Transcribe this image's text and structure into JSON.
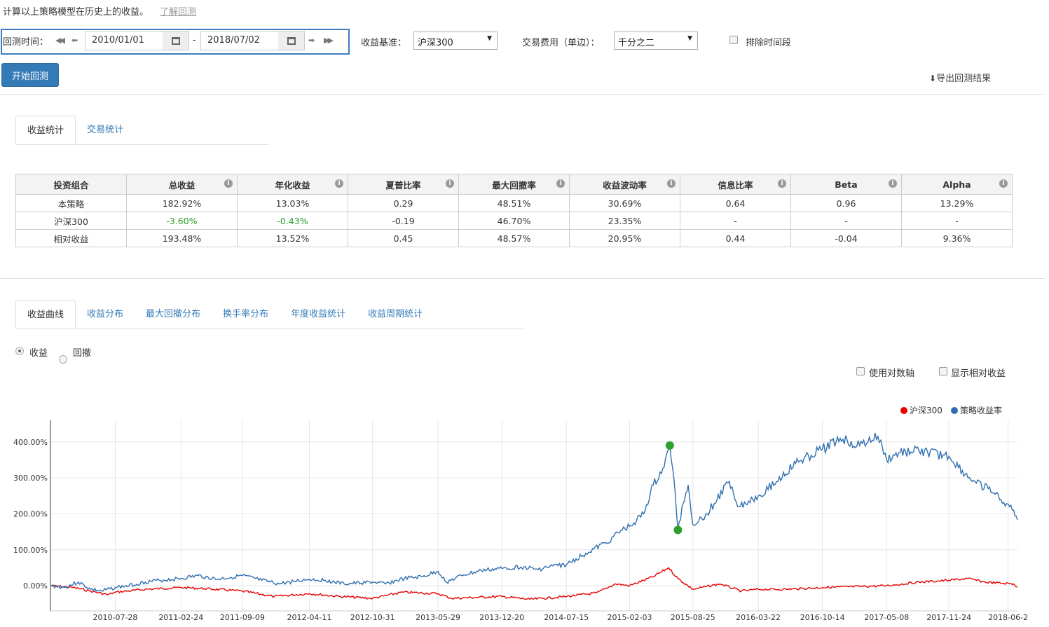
{
  "intro": {
    "text": "计算以上策略模型在历史上的收益。",
    "link": "了解回测"
  },
  "controls": {
    "range_label": "回测时间：",
    "start_date": "2010/01/01",
    "end_date": "2018/07/02",
    "dash": "-",
    "benchmark_label": "收益基准：",
    "benchmark_value": "沪深300",
    "fee_label": "交易费用（单边）：",
    "fee_value": "千分之二",
    "exclude_label": "排除时间段",
    "start_button": "开始回测",
    "export_label": "导出回测结果"
  },
  "stat_tabs": [
    "收益统计",
    "交易统计"
  ],
  "stats_table": {
    "headers": [
      "投资组合",
      "总收益",
      "年化收益",
      "夏普比率",
      "最大回撤率",
      "收益波动率",
      "信息比率",
      "Beta",
      "Alpha"
    ],
    "rows": [
      [
        "本策略",
        "182.92%",
        "13.03%",
        "0.29",
        "48.51%",
        "30.69%",
        "0.64",
        "0.96",
        "13.29%"
      ],
      [
        "沪深300",
        "-3.60%",
        "-0.43%",
        "-0.19",
        "46.70%",
        "23.35%",
        "-",
        "-",
        "-"
      ],
      [
        "相对收益",
        "193.48%",
        "13.52%",
        "0.45",
        "48.57%",
        "20.95%",
        "0.44",
        "-0.04",
        "9.36%"
      ]
    ]
  },
  "chart_tabs": [
    "收益曲线",
    "收益分布",
    "最大回撤分布",
    "换手率分布",
    "年度收益统计",
    "收益周期统计"
  ],
  "radio_options": [
    "收益",
    "回撤"
  ],
  "chart_options": [
    "使用对数轴",
    "显示相对收益"
  ],
  "colors": {
    "accent": "#337ab7",
    "strategy": "#2f6fb0",
    "benchmark": "#e60000",
    "marker": "#2ea02e",
    "negative": "#2a9d2a"
  },
  "chart_data": {
    "type": "line",
    "x_ticks": [
      "2010-07-28",
      "2011-02-24",
      "2011-09-09",
      "2012-04-11",
      "2012-10-31",
      "2013-05-29",
      "2013-12-20",
      "2014-07-15",
      "2015-02-03",
      "2015-08-25",
      "2016-03-22",
      "2016-10-14",
      "2017-05-08",
      "2017-11-24",
      "2018-06-2"
    ],
    "y_ticks": [
      "0.00%",
      "100.00%",
      "200.00%",
      "300.00%",
      "400.00%"
    ],
    "ylim": [
      -70,
      460
    ],
    "xlim": [
      "2010-01-01",
      "2018-07-02"
    ],
    "legend": [
      "沪深300",
      "策略收益率"
    ],
    "legend_position": "top-right",
    "series": [
      {
        "name": "策略收益率",
        "points": [
          [
            "2010-01-01",
            0
          ],
          [
            "2010-02-15",
            -5
          ],
          [
            "2010-04-01",
            10
          ],
          [
            "2010-05-10",
            -10
          ],
          [
            "2010-06-15",
            -15
          ],
          [
            "2010-07-28",
            -5
          ],
          [
            "2010-09-10",
            0
          ],
          [
            "2010-11-01",
            10
          ],
          [
            "2010-12-20",
            15
          ],
          [
            "2011-02-24",
            20
          ],
          [
            "2011-04-20",
            28
          ],
          [
            "2011-06-20",
            18
          ],
          [
            "2011-09-09",
            28
          ],
          [
            "2011-11-10",
            15
          ],
          [
            "2012-01-05",
            5
          ],
          [
            "2012-02-20",
            12
          ],
          [
            "2012-04-11",
            18
          ],
          [
            "2012-06-01",
            15
          ],
          [
            "2012-08-01",
            5
          ],
          [
            "2012-10-31",
            10
          ],
          [
            "2012-12-10",
            5
          ],
          [
            "2013-02-10",
            20
          ],
          [
            "2013-04-10",
            25
          ],
          [
            "2013-05-29",
            40
          ],
          [
            "2013-06-25",
            10
          ],
          [
            "2013-08-20",
            30
          ],
          [
            "2013-10-15",
            42
          ],
          [
            "2013-12-20",
            48
          ],
          [
            "2014-02-20",
            52
          ],
          [
            "2014-04-15",
            45
          ],
          [
            "2014-06-01",
            55
          ],
          [
            "2014-07-15",
            58
          ],
          [
            "2014-09-15",
            90
          ],
          [
            "2014-11-20",
            120
          ],
          [
            "2015-01-10",
            155
          ],
          [
            "2015-02-03",
            165
          ],
          [
            "2015-03-20",
            200
          ],
          [
            "2015-04-20",
            280
          ],
          [
            "2015-05-25",
            330
          ],
          [
            "2015-06-12",
            390
          ],
          [
            "2015-06-25",
            300
          ],
          [
            "2015-07-08",
            155
          ],
          [
            "2015-07-25",
            230
          ],
          [
            "2015-08-10",
            280
          ],
          [
            "2015-08-25",
            170
          ],
          [
            "2015-10-10",
            200
          ],
          [
            "2015-12-20",
            290
          ],
          [
            "2016-01-20",
            220
          ],
          [
            "2016-03-22",
            250
          ],
          [
            "2016-05-20",
            290
          ],
          [
            "2016-07-20",
            340
          ],
          [
            "2016-10-14",
            380
          ],
          [
            "2016-12-10",
            410
          ],
          [
            "2017-02-10",
            390
          ],
          [
            "2017-04-10",
            415
          ],
          [
            "2017-05-08",
            350
          ],
          [
            "2017-06-20",
            370
          ],
          [
            "2017-08-20",
            375
          ],
          [
            "2017-11-24",
            360
          ],
          [
            "2018-01-15",
            310
          ],
          [
            "2018-02-20",
            285
          ],
          [
            "2018-03-30",
            270
          ],
          [
            "2018-05-10",
            240
          ],
          [
            "2018-06-20",
            210
          ],
          [
            "2018-07-02",
            183
          ]
        ]
      },
      {
        "name": "沪深300",
        "points": [
          [
            "2010-01-01",
            0
          ],
          [
            "2010-03-15",
            -5
          ],
          [
            "2010-05-10",
            -15
          ],
          [
            "2010-07-05",
            -25
          ],
          [
            "2010-07-28",
            -18
          ],
          [
            "2010-11-01",
            -10
          ],
          [
            "2011-02-24",
            -5
          ],
          [
            "2011-05-10",
            -8
          ],
          [
            "2011-09-09",
            -15
          ],
          [
            "2011-12-20",
            -30
          ],
          [
            "2012-04-11",
            -22
          ],
          [
            "2012-07-20",
            -30
          ],
          [
            "2012-10-31",
            -35
          ],
          [
            "2013-02-05",
            -18
          ],
          [
            "2013-05-29",
            -22
          ],
          [
            "2013-07-10",
            -35
          ],
          [
            "2013-12-20",
            -30
          ],
          [
            "2014-03-20",
            -38
          ],
          [
            "2014-07-15",
            -30
          ],
          [
            "2014-10-20",
            -20
          ],
          [
            "2014-12-20",
            5
          ],
          [
            "2015-02-03",
            0
          ],
          [
            "2015-04-20",
            25
          ],
          [
            "2015-06-08",
            50
          ],
          [
            "2015-07-08",
            20
          ],
          [
            "2015-08-25",
            -10
          ],
          [
            "2015-11-20",
            5
          ],
          [
            "2016-01-28",
            -15
          ],
          [
            "2016-03-22",
            -10
          ],
          [
            "2016-06-20",
            -10
          ],
          [
            "2016-10-14",
            -5
          ],
          [
            "2017-05-08",
            0
          ],
          [
            "2017-08-20",
            10
          ],
          [
            "2017-11-24",
            15
          ],
          [
            "2018-01-24",
            20
          ],
          [
            "2018-03-20",
            10
          ],
          [
            "2018-06-20",
            5
          ],
          [
            "2018-07-02",
            -4
          ]
        ]
      }
    ],
    "markers": [
      {
        "date": "2015-06-12",
        "value": 390
      },
      {
        "date": "2015-07-08",
        "value": 155
      }
    ]
  }
}
